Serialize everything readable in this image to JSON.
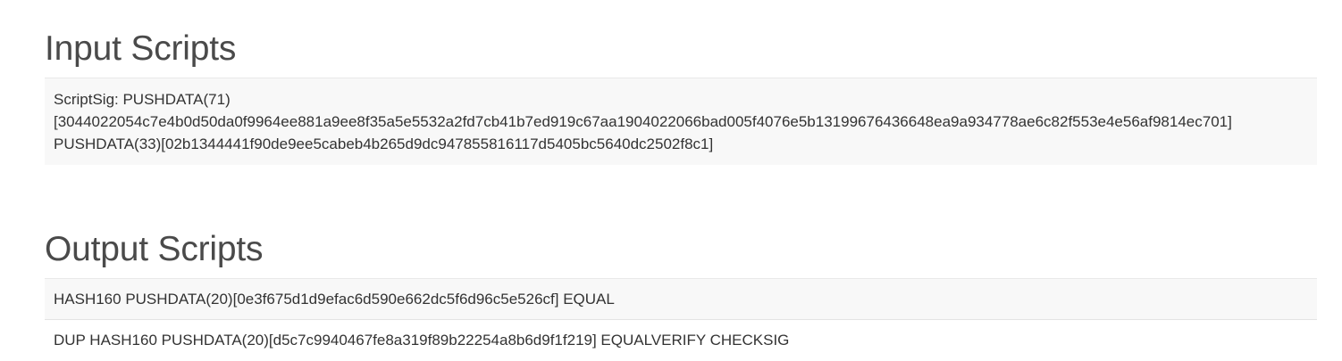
{
  "input_section": {
    "title": "Input Scripts",
    "script_sig": {
      "line1": "ScriptSig: PUSHDATA(71)",
      "line2": "[3044022054c7e4b0d50da0f9964ee881a9ee8f35a5e5532a2fd7cb41b7ed919c67aa1904022066bad005f4076e5b13199676436648ea9a934778ae6c82f553e4e56af9814ec701]",
      "line3": "PUSHDATA(33)[02b1344441f90de9ee5cabeb4b265d9dc947855816117d5405bc5640dc2502f8c1]"
    }
  },
  "output_section": {
    "title": "Output Scripts",
    "scripts": [
      "HASH160 PUSHDATA(20)[0e3f675d1d9efac6d590e662dc5f6d96c5e526cf] EQUAL",
      "DUP HASH160 PUSHDATA(20)[d5c7c9940467fe8a319f89b22254a8b6d9f1f219] EQUALVERIFY CHECKSIG"
    ]
  }
}
